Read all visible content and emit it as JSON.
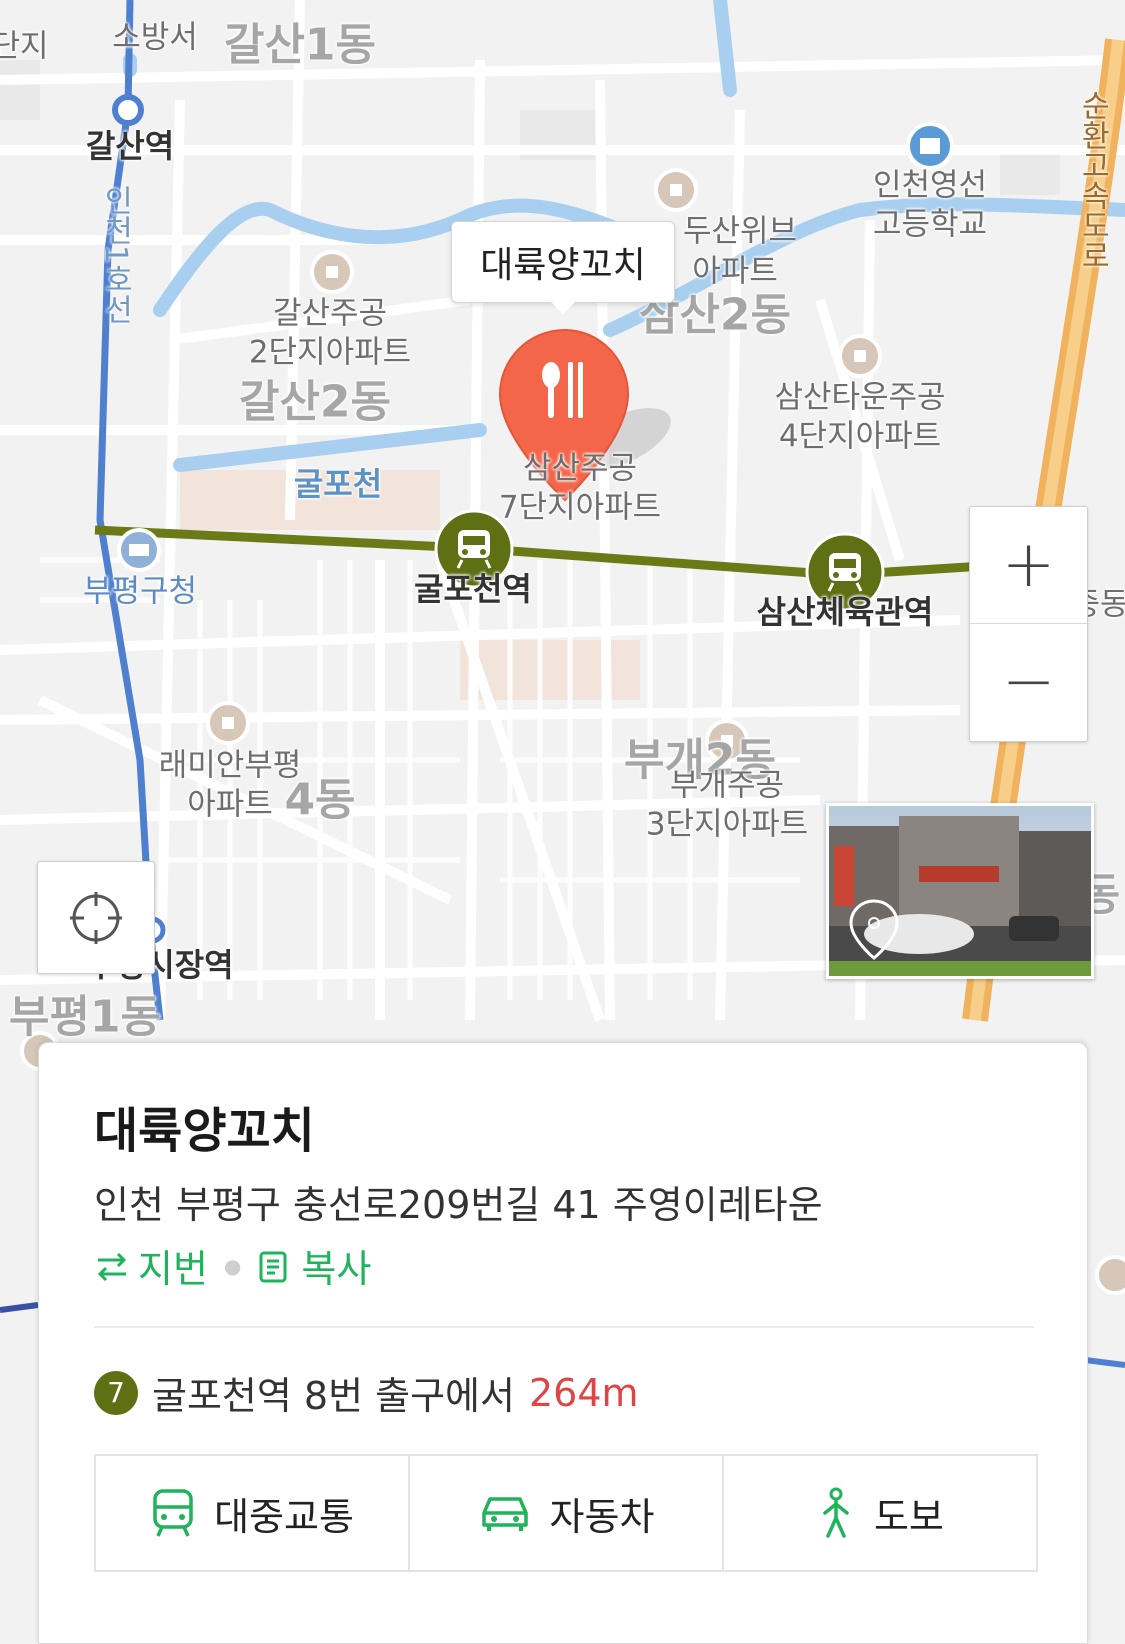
{
  "map": {
    "districts": [
      "갈산1동",
      "갈산2동",
      "삼산2동",
      "부개2동",
      "4동",
      "부평1동",
      "중동",
      "동"
    ],
    "stations": [
      "갈산역",
      "굴포천역",
      "삼산체육관역",
      "부평구청",
      "부평시장역"
    ],
    "lines": [
      "인천1호선"
    ],
    "roads": [
      "순환고속도로"
    ],
    "waterways": [
      "굴포천"
    ],
    "pois": [
      "소방서",
      "두산위브",
      "아파트",
      "갈산주공\n2단지아파트",
      "삼산주공\n7단지아파트",
      "삼산타운주공\n4단지아파트",
      "인천영선\n고등학교",
      "래미안부평\n아파트",
      "부개주공\n3단지아파트",
      "단지"
    ],
    "marker_callout": "대륙양꼬치",
    "colors": {
      "marker": "#f4664a",
      "subway_line7": "#6b7a17",
      "subway_line1": "#4f7fcf",
      "highway": "#f0a94a",
      "river": "#a9cff0"
    }
  },
  "controls": {
    "zoom_in": "+",
    "zoom_out": "−",
    "icons": [
      "locate-icon",
      "restaurant-icon",
      "bus-icon",
      "car-icon",
      "walk-icon",
      "swap-icon",
      "copy-icon",
      "roadview-pin-icon"
    ]
  },
  "place": {
    "name": "대륙양꼬치",
    "address": "인천 부평구 충선로209번길 41 주영이레타운",
    "jibun_label": "지번",
    "copy_label": "복사",
    "line_number": "7",
    "transit_text": "굴포천역 8번 출구에서",
    "distance": "264m"
  },
  "nav": {
    "transit": "대중교통",
    "car": "자동차",
    "walk": "도보"
  }
}
